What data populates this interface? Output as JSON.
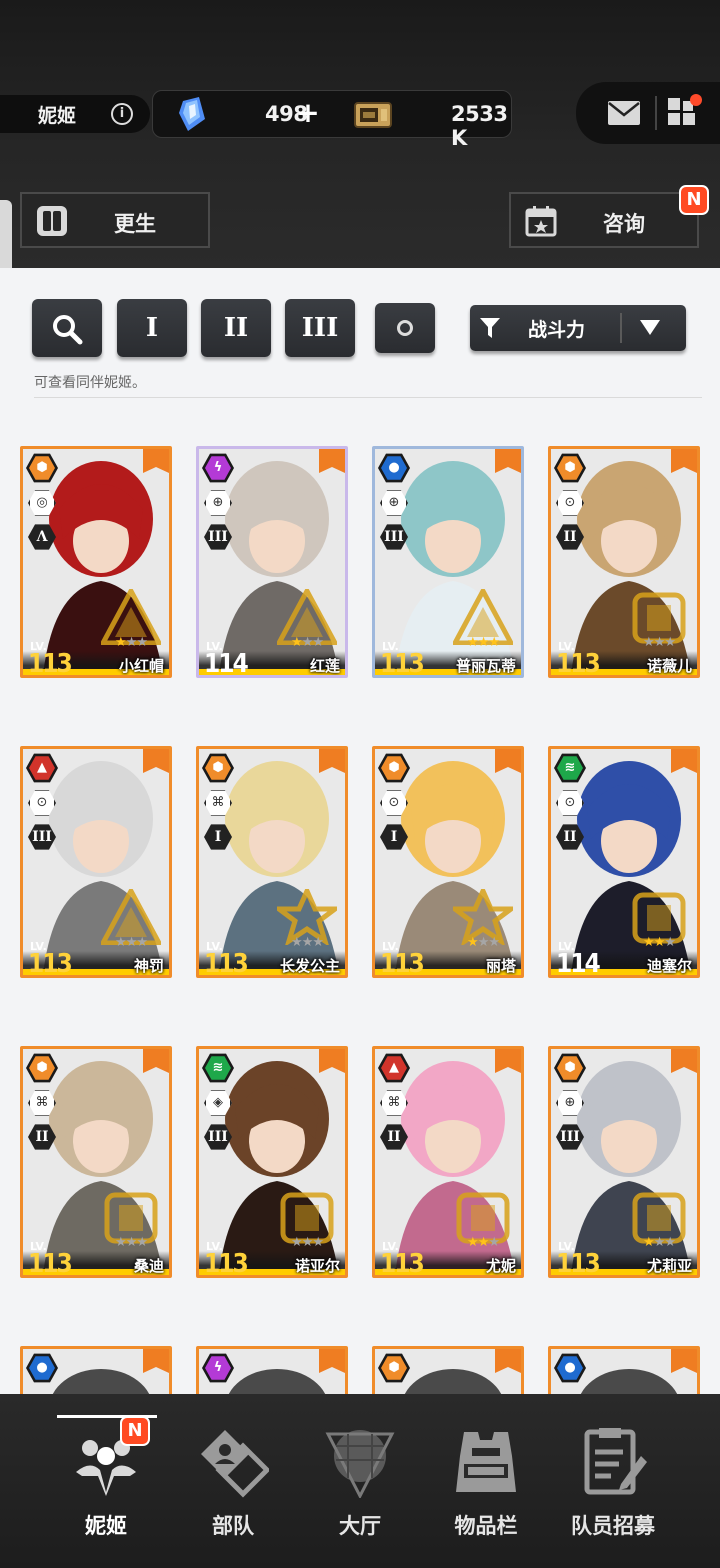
{
  "header": {
    "player_name": "妮姬",
    "gems": "498",
    "credits": "2533 K",
    "plus": "+"
  },
  "buttons": {
    "rebirth": "更生",
    "consult": "咨询",
    "new_badge": "N"
  },
  "filters": {
    "class_1": "I",
    "class_2": "II",
    "class_3": "III",
    "sort_label": "战斗力",
    "hint": "可查看同伴妮姬。"
  },
  "cards": [
    {
      "name": "小红帽",
      "lv_label": "LV.",
      "level": "113",
      "stars": 1,
      "element": "core",
      "burst": "Λ",
      "weapon": "smg"
    },
    {
      "name": "红莲",
      "lv_label": "LV.",
      "level": "114",
      "stars": 1,
      "element": "electric",
      "burst": "III",
      "weapon": "ar"
    },
    {
      "name": "普丽瓦蒂",
      "lv_label": "LV.",
      "level": "113",
      "stars": 3,
      "element": "water",
      "burst": "III",
      "weapon": "ar"
    },
    {
      "name": "诺薇儿",
      "lv_label": "LV.",
      "level": "113",
      "stars": 0,
      "element": "core",
      "burst": "II",
      "weapon": "sr"
    },
    {
      "name": "神罚",
      "lv_label": "LV.",
      "level": "113",
      "stars": 0,
      "element": "fire",
      "burst": "III",
      "weapon": "sr"
    },
    {
      "name": "长发公主",
      "lv_label": "LV.",
      "level": "113",
      "stars": 0,
      "element": "core",
      "burst": "I",
      "weapon": "rl"
    },
    {
      "name": "丽塔",
      "lv_label": "LV.",
      "level": "113",
      "stars": 1,
      "element": "core",
      "burst": "I",
      "weapon": "sr"
    },
    {
      "name": "迪塞尔",
      "lv_label": "LV.",
      "level": "114",
      "stars": 2,
      "element": "wind",
      "burst": "II",
      "weapon": "sr"
    },
    {
      "name": "桑迪",
      "lv_label": "LV.",
      "level": "113",
      "stars": 0,
      "element": "core",
      "burst": "II",
      "weapon": "rl"
    },
    {
      "name": "诺亚尔",
      "lv_label": "LV.",
      "level": "113",
      "stars": 0,
      "element": "wind",
      "burst": "III",
      "weapon": "sg"
    },
    {
      "name": "尤妮",
      "lv_label": "LV.",
      "level": "113",
      "stars": 2,
      "element": "fire",
      "burst": "II",
      "weapon": "rl"
    },
    {
      "name": "尤莉亚",
      "lv_label": "LV.",
      "level": "113",
      "stars": 1,
      "element": "core",
      "burst": "III",
      "weapon": "ar"
    }
  ],
  "partial_cards": [
    {
      "element": "water"
    },
    {
      "element": "electric"
    },
    {
      "element": "core"
    },
    {
      "element": "water"
    }
  ],
  "nav": [
    {
      "label": "妮姬",
      "icon": "nikke-icon"
    },
    {
      "label": "部队",
      "icon": "squad-icon"
    },
    {
      "label": "大厅",
      "icon": "lobby-icon"
    },
    {
      "label": "物品栏",
      "icon": "inventory-icon"
    },
    {
      "label": "队员招募",
      "icon": "recruit-icon"
    }
  ],
  "colors": {
    "accent_orange": "#f08c2a",
    "level_yellow": "#ffd23a",
    "badge_red": "#ff4a22",
    "core": "#f08c2a",
    "electric": "#b43ad6",
    "water": "#1f6bd0",
    "fire": "#d1342b",
    "wind": "#1ea84a"
  }
}
